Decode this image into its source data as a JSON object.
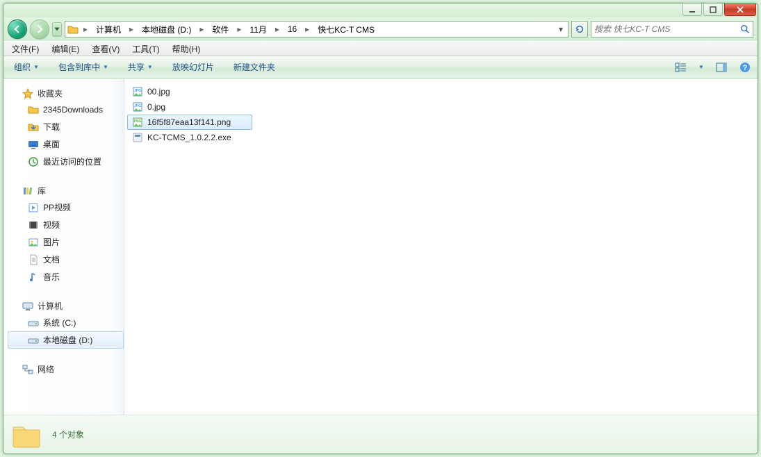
{
  "window_controls": {
    "minimize": "minimize",
    "maximize": "maximize",
    "close": "close"
  },
  "breadcrumbs": [
    "计算机",
    "本地磁盘 (D:)",
    "软件",
    "11月",
    "16",
    "快七KC-T CMS"
  ],
  "search": {
    "placeholder": "搜索 快七KC-T CMS"
  },
  "menubar": {
    "file": "文件(F)",
    "edit": "编辑(E)",
    "view": "查看(V)",
    "tools": "工具(T)",
    "help": "帮助(H)"
  },
  "toolbar": {
    "organize": "组织",
    "include": "包含到库中",
    "share": "共享",
    "slideshow": "放映幻灯片",
    "newfolder": "新建文件夹"
  },
  "sidebar": {
    "favorites": {
      "label": "收藏夹",
      "items": [
        "2345Downloads",
        "下载",
        "桌面",
        "最近访问的位置"
      ]
    },
    "libraries": {
      "label": "库",
      "items": [
        "PP视频",
        "视频",
        "图片",
        "文档",
        "音乐"
      ]
    },
    "computer": {
      "label": "计算机",
      "items": [
        "系统 (C:)",
        "本地磁盘 (D:)"
      ],
      "selected_index": 1
    },
    "network": {
      "label": "网络"
    }
  },
  "files": [
    {
      "name": "00.jpg",
      "type": "jpg",
      "selected": false
    },
    {
      "name": "0.jpg",
      "type": "jpg",
      "selected": false
    },
    {
      "name": "16f5f87eaa13f141.png",
      "type": "png",
      "selected": true
    },
    {
      "name": "KC-TCMS_1.0.2.2.exe",
      "type": "exe",
      "selected": false
    }
  ],
  "details": {
    "summary": "4 个对象"
  }
}
